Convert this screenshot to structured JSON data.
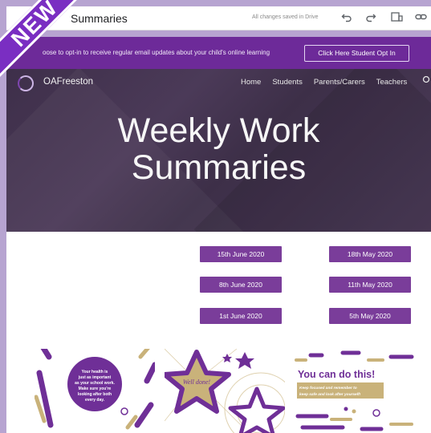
{
  "topbar": {
    "doc_title": "Summaries",
    "save_status": "All changes saved in Drive",
    "icons": [
      "undo-icon",
      "redo-icon",
      "preview-icon",
      "link-icon"
    ]
  },
  "optin": {
    "message": "oose to opt-in to receive regular email updates about your child's online learning",
    "button_label": "Click Here Student Opt In"
  },
  "site": {
    "name": "OAFreeston",
    "nav": [
      "Home",
      "Students",
      "Parents/Carers",
      "Teachers"
    ]
  },
  "hero": {
    "line1": "Weekly Work",
    "line2": "Summaries"
  },
  "summaries": {
    "left": [
      "15th June 2020",
      "8th June 2020",
      "1st June 2020"
    ],
    "right": [
      "18th May 2020",
      "11th May 2020",
      "5th May 2020"
    ]
  },
  "cards": {
    "card1_text": [
      "Your health is",
      "just as important",
      "as your school work.",
      "Make sure you're",
      "looking after both",
      "every day."
    ],
    "card2_text": [
      "Well done!"
    ],
    "card3_title": "You can do this!",
    "card3_sub": [
      "Keep focused and remember to",
      "keep safe and look after yourself!"
    ]
  },
  "ribbon": {
    "label": "NEW"
  },
  "colors": {
    "brand_purple": "#7a3d9a",
    "banner_purple": "#6d2a99",
    "gold": "#c9b27a",
    "hero_dark": "#3e2f4a"
  }
}
